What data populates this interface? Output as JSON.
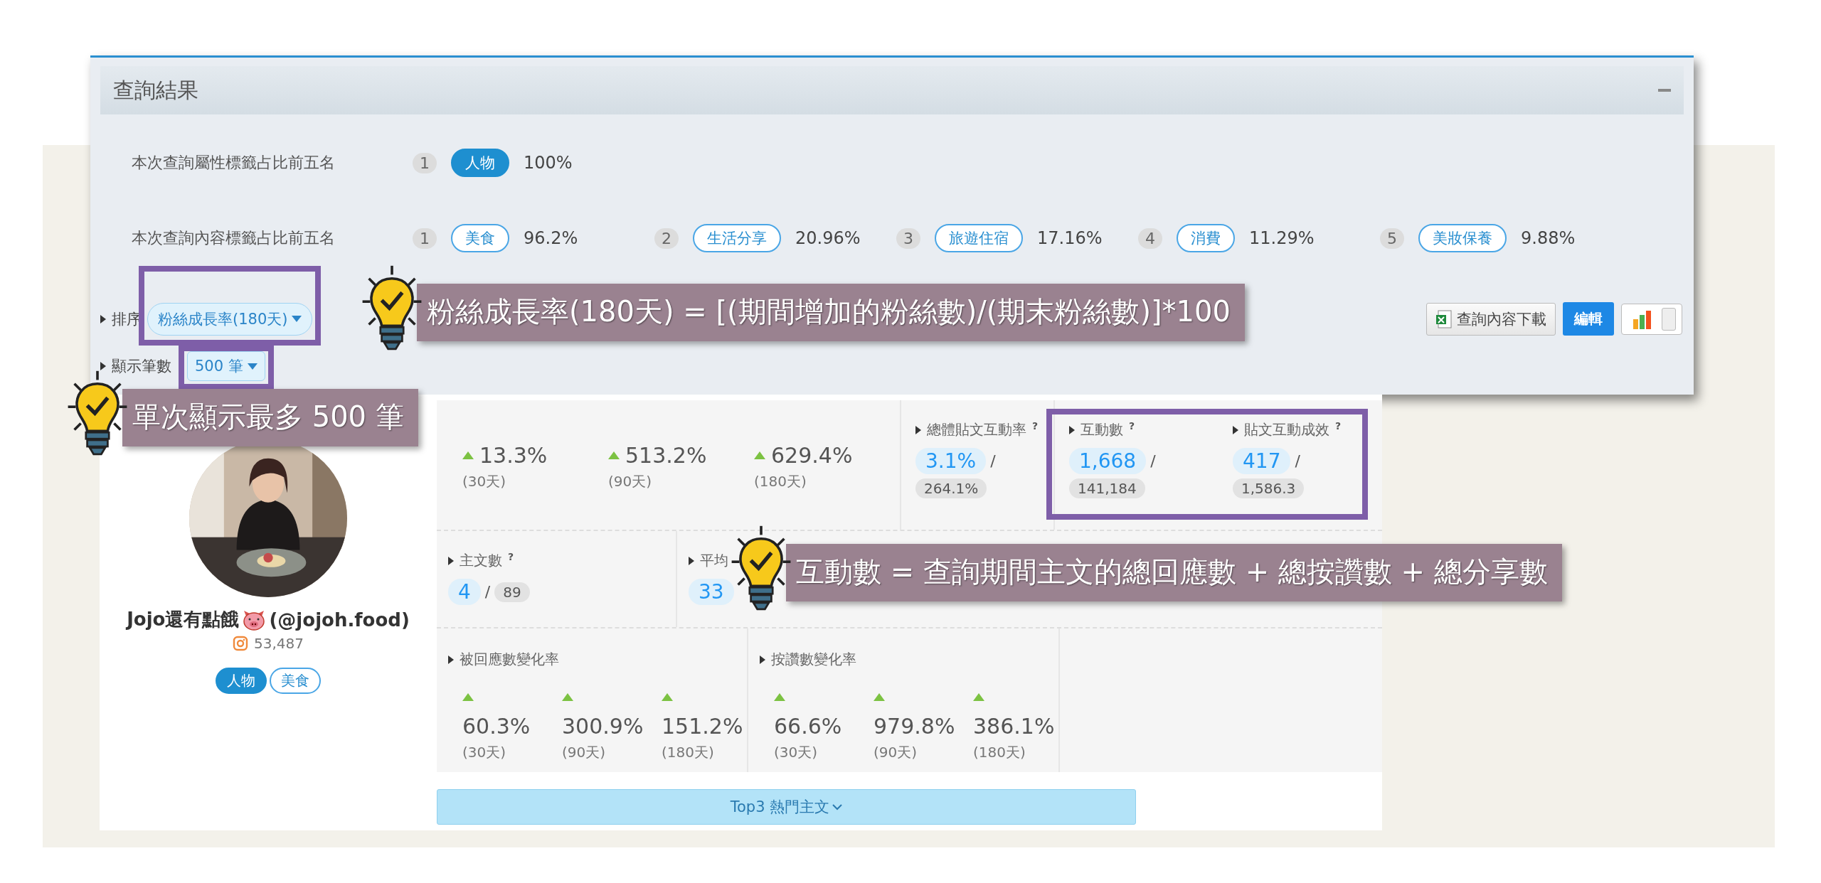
{
  "panel": {
    "title": "查詢結果"
  },
  "tag_rankings": [
    {
      "label": "本次查詢屬性標籤占比前五名",
      "items": [
        {
          "rank": "1",
          "tag": "人物",
          "kind": "filled",
          "share": "100%"
        }
      ]
    },
    {
      "label": "本次查詢內容標籤占比前五名",
      "items": [
        {
          "rank": "1",
          "tag": "美食",
          "kind": "outline",
          "share": "96.2%"
        },
        {
          "rank": "2",
          "tag": "生活分享",
          "kind": "outline",
          "share": "20.96%"
        },
        {
          "rank": "3",
          "tag": "旅遊住宿",
          "kind": "outline",
          "share": "17.16%"
        },
        {
          "rank": "4",
          "tag": "消費",
          "kind": "outline",
          "share": "11.29%"
        },
        {
          "rank": "5",
          "tag": "美妝保養",
          "kind": "outline",
          "share": "9.88%"
        }
      ]
    }
  ],
  "sort": {
    "label": "排序",
    "value": "粉絲成長率(180天)"
  },
  "page_size": {
    "label": "顯示筆數",
    "value": "500 筆"
  },
  "toolbar": {
    "download": "查詢內容下載",
    "edit": "編輯",
    "chart_view_on": true
  },
  "profile": {
    "name": "Jojo還有點餓",
    "handle": "(@jojoh.food)",
    "followers": "53,487",
    "tags": [
      {
        "label": "人物",
        "kind": "filled"
      },
      {
        "label": "美食",
        "kind": "outline"
      }
    ]
  },
  "growth": [
    {
      "rising": true,
      "value": "13.3%",
      "period": "(30天)"
    },
    {
      "rising": true,
      "value": "513.2%",
      "period": "(90天)"
    },
    {
      "rising": true,
      "value": "629.4%",
      "period": "(180天)"
    }
  ],
  "metrics": [
    {
      "label": "總體貼文互動率",
      "help": "?",
      "value": "3.1%",
      "separator": "/",
      "average": "264.1%"
    },
    {
      "label": "互動數",
      "help": "?",
      "value": "1,668",
      "separator": "/",
      "average": "141,184"
    },
    {
      "label": "貼文互動成效",
      "help": "?",
      "value": "417",
      "separator": "/",
      "average": "1,586.3"
    }
  ],
  "posts": [
    {
      "label": "主文數",
      "help": "?",
      "value": "4",
      "separator": "/",
      "total": "89"
    },
    {
      "label": "平均",
      "value": "33"
    }
  ],
  "changes": [
    {
      "label": "被回應數變化率",
      "values": [
        {
          "rising": true,
          "value": "60.3%",
          "period": "(30天)"
        },
        {
          "rising": true,
          "value": "300.9%",
          "period": "(90天)"
        },
        {
          "rising": true,
          "value": "151.2%",
          "period": "(180天)"
        }
      ]
    },
    {
      "label": "按讚數變化率",
      "values": [
        {
          "rising": true,
          "value": "66.6%",
          "period": "(30天)"
        },
        {
          "rising": true,
          "value": "979.8%",
          "period": "(90天)"
        },
        {
          "rising": true,
          "value": "386.1%",
          "period": "(180天)"
        }
      ]
    }
  ],
  "top_posts_button": "Top3 熱門主文",
  "callouts": [
    {
      "text": "粉絲成長率(180天) = [(期間增加的粉絲數)/(期末粉絲數)]*100"
    },
    {
      "text": "單次顯示最多 500 筆"
    },
    {
      "text": "互動數 = 查詢期間主文的總回應數 + 總按讚數 + 總分享數"
    }
  ]
}
